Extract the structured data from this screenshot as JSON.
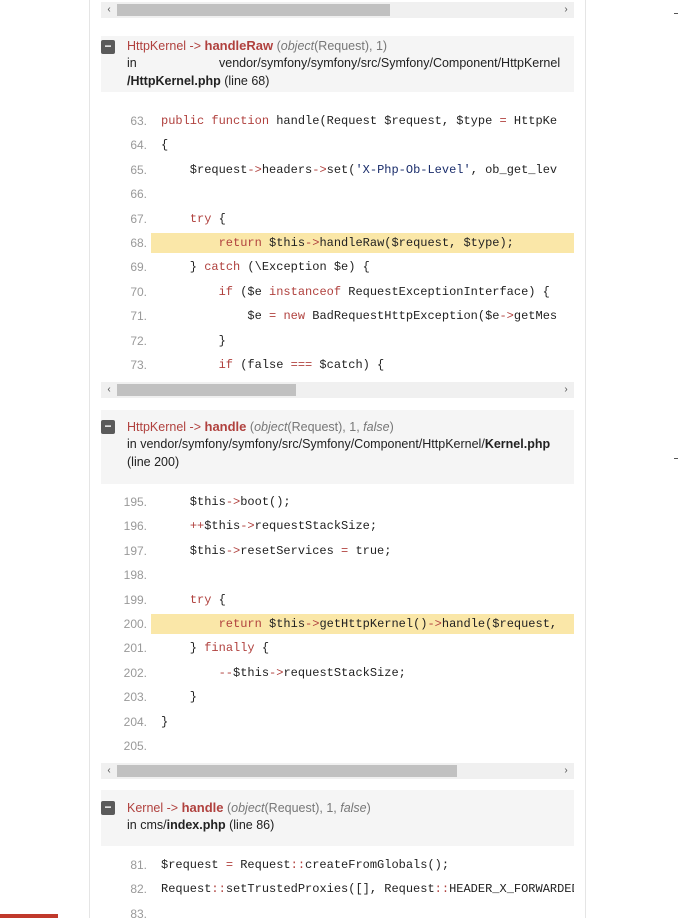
{
  "frames": [
    {
      "class": "HttpKernel",
      "arrow": "->",
      "function": "handleRaw",
      "args_open": "(",
      "arg_type": "object",
      "arg_rest": "(Request), 1)",
      "loc_in": "in",
      "path": "vendor/symfony/symfony/src/Symfony/Component/HttpKernel",
      "file": "/HttpKernel.php",
      "line": "(line 68)",
      "lines": [
        {
          "n": "63.",
          "html": "<span class='kw'>public function</span> handle(Request $request, $type <span class='op'>=</span> HttpKe"
        },
        {
          "n": "64.",
          "html": "{"
        },
        {
          "n": "65.",
          "html": "    $request<span class='op'>-></span>headers<span class='op'>-></span>set(<span class='str'>'X-Php-Ob-Level'</span>, ob_get_lev"
        },
        {
          "n": "66.",
          "html": ""
        },
        {
          "n": "67.",
          "html": "    <span class='kw'>try</span> {"
        },
        {
          "n": "68.",
          "html": "        <span class='kw'>return</span> $this<span class='op'>-></span>handleRaw($request, $type);",
          "hl": true
        },
        {
          "n": "69.",
          "html": "    } <span class='kw'>catch</span> (\\Exception $e) {"
        },
        {
          "n": "70.",
          "html": "        <span class='kw'>if</span> ($e <span class='kw'>instanceof</span> RequestExceptionInterface) {"
        },
        {
          "n": "71.",
          "html": "            $e <span class='op'>=</span> <span class='kw'>new</span> BadRequestHttpException($e<span class='op'>-></span>getMes"
        },
        {
          "n": "72.",
          "html": "        }"
        },
        {
          "n": "73.",
          "html": "        <span class='kw'>if</span> (false <span class='op'>===</span> $catch) {"
        }
      ]
    },
    {
      "class": "HttpKernel",
      "arrow": "->",
      "function": "handle",
      "args_open": "(",
      "arg_type": "object",
      "arg_rest": "(Request), 1, ",
      "arg_false": "false",
      "arg_close": ")",
      "loc_in": "in",
      "path": "vendor/symfony/symfony/src/Symfony/Component/HttpKernel/",
      "file": "Kernel.php",
      "line": "(line 200)",
      "lines": [
        {
          "n": "195.",
          "html": "    $this<span class='op'>-></span>boot();"
        },
        {
          "n": "196.",
          "html": "    <span class='op'>++</span>$this<span class='op'>-></span>requestStackSize;"
        },
        {
          "n": "197.",
          "html": "    $this<span class='op'>-></span>resetServices <span class='op'>=</span> true;"
        },
        {
          "n": "198.",
          "html": ""
        },
        {
          "n": "199.",
          "html": "    <span class='kw'>try</span> {"
        },
        {
          "n": "200.",
          "html": "        <span class='kw'>return</span> $this<span class='op'>-></span>getHttpKernel()<span class='op'>-></span>handle($request,",
          "hl": true
        },
        {
          "n": "201.",
          "html": "    } <span class='kw'>finally</span> {"
        },
        {
          "n": "202.",
          "html": "        <span class='op'>--</span>$this<span class='op'>-></span>requestStackSize;"
        },
        {
          "n": "203.",
          "html": "    }"
        },
        {
          "n": "204.",
          "html": "}"
        },
        {
          "n": "205.",
          "html": ""
        }
      ]
    },
    {
      "class": "Kernel",
      "arrow": "->",
      "function": "handle",
      "args_open": "(",
      "arg_type": "object",
      "arg_rest": "(Request), 1, ",
      "arg_false": "false",
      "arg_close": ")",
      "loc_in": "in cms/",
      "file": "index.php",
      "line": "(line 86)",
      "lines": [
        {
          "n": "81.",
          "html": "$request <span class='op'>=</span> Request<span class='op'>::</span>createFromGlobals();"
        },
        {
          "n": "82.",
          "html": "Request<span class='op'>::</span>setTrustedProxies([], Request<span class='op'>::</span>HEADER_X_FORWARDED_"
        },
        {
          "n": "83.",
          "html": ""
        }
      ]
    }
  ],
  "toggle_symbol": "−",
  "scroll_left": "‹",
  "scroll_right": "›"
}
